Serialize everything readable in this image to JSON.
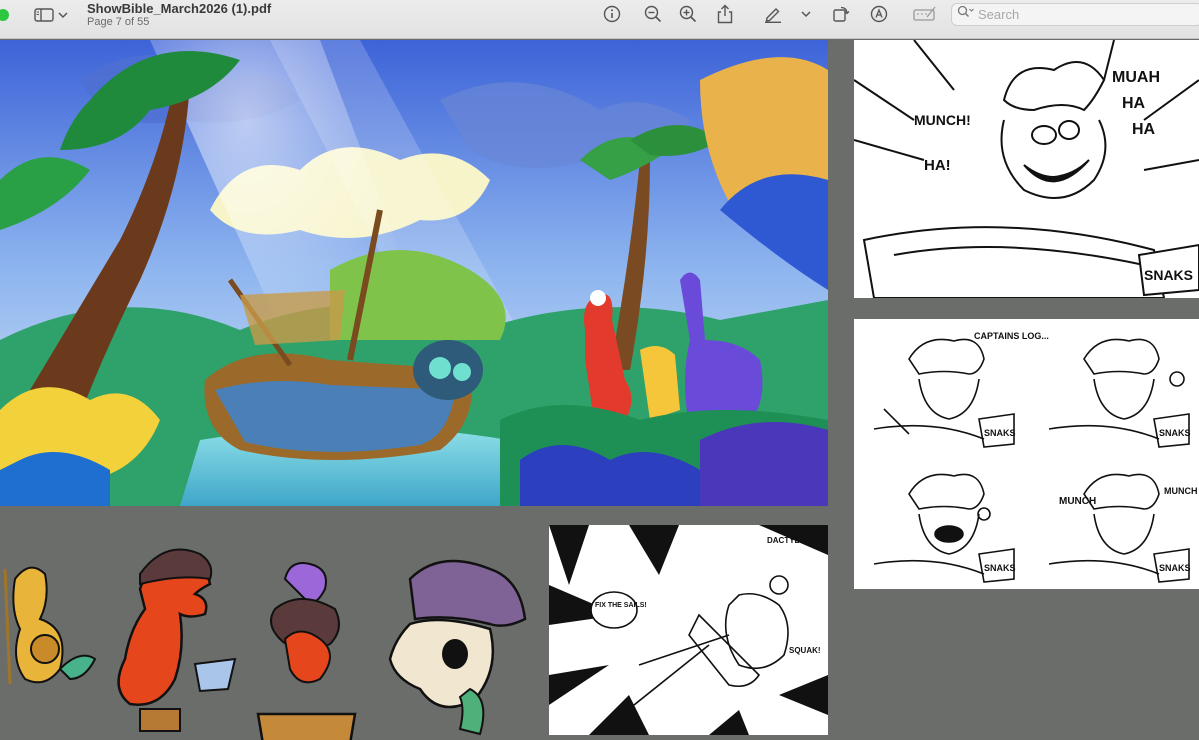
{
  "window": {
    "title": "ShowBible_March2026 (1).pdf",
    "page_indicator": "Page 7 of 55"
  },
  "toolbar": {
    "icons": [
      "sidebar-icon",
      "chevron-down-icon",
      "info-icon",
      "zoom-out-icon",
      "zoom-in-icon",
      "share-icon",
      "highlighter-icon",
      "chevron-down-icon",
      "rotate-icon",
      "markup-icon",
      "form-icon",
      "search-icon"
    ]
  },
  "search": {
    "placeholder": "Search"
  },
  "storyboards": {
    "panel_a": {
      "sfx": [
        "MUNCH!",
        "HA!",
        "MUAH",
        "HA",
        "HA"
      ],
      "label": "SNAKS"
    },
    "panel_b": {
      "captions": [
        "CAPTAINS LOG...",
        "MUNCH",
        "MUNCH"
      ],
      "labels": [
        "SNAKS",
        "SNAKS",
        "SNAKS",
        "SNAKS"
      ]
    },
    "panel_c": {
      "captions": [
        "DACTYL",
        "FIX THE SAILS!",
        "SQUAK!"
      ]
    }
  },
  "colors": {
    "toolbar_bg": "#e6e6e6",
    "page_bg": "#6b6d6b",
    "window_green": "#2ec840"
  }
}
